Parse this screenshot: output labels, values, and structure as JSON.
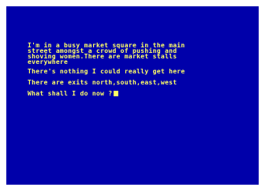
{
  "screen": {
    "description_lines": [
      "I'm in a busy market square in the main",
      "street amongst a crowd of pushing and",
      "shoving women.There are market stalls",
      "everywhere"
    ],
    "nothing_text": "There's nothing I could really get here",
    "exits_text": "There are exits north,south,east,west",
    "prompt_text": "What shall I do now ?",
    "cursor": "block-cursor"
  },
  "colors": {
    "border": "#ffffff",
    "background": "#0000aa",
    "text": "#ffff66"
  }
}
